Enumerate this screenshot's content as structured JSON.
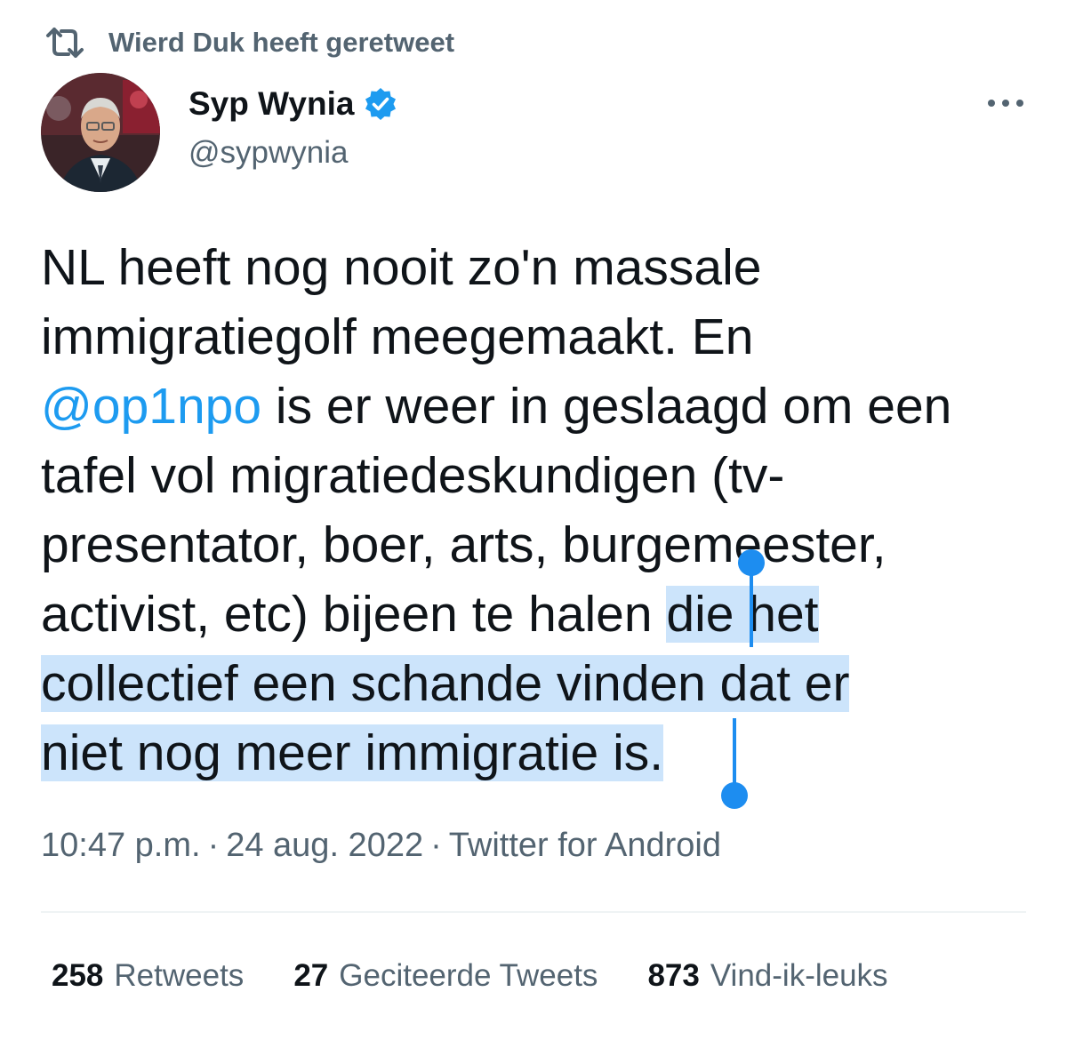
{
  "retweet_context": {
    "text": "Wierd Duk heeft geretweet",
    "icon": "retweet-icon"
  },
  "author": {
    "name": "Syp Wynia",
    "handle": "@sypwynia",
    "verified": true,
    "verified_color": "#1d9bf0"
  },
  "more_icon": "more-dots-icon",
  "tweet": {
    "lines": [
      "NL heeft nog nooit zo'n massale",
      "immigratiegolf meegemaakt. En",
      " is er weer in geslaagd om een",
      "tafel vol migratiedeskundigen (tv-",
      "presentator, boer, arts, burgemeester,",
      "activist, etc) bijeen te halen ",
      "die het",
      "collectief een schande vinden dat er",
      "niet nog meer immigratie is."
    ],
    "mention": "@op1npo"
  },
  "meta": {
    "time": "10:47 p.m.",
    "date": "24 aug. 2022",
    "source": "Twitter for Android",
    "separator": "·"
  },
  "stats": [
    {
      "count": "258",
      "label": "Retweets"
    },
    {
      "count": "27",
      "label": "Geciteerde Tweets"
    },
    {
      "count": "873",
      "label": "Vind-ik-leuks"
    }
  ],
  "colors": {
    "link": "#1d9bf0",
    "selection": "#cce4fb",
    "selection_handle": "#1d8df0",
    "secondary_text": "#536471"
  }
}
